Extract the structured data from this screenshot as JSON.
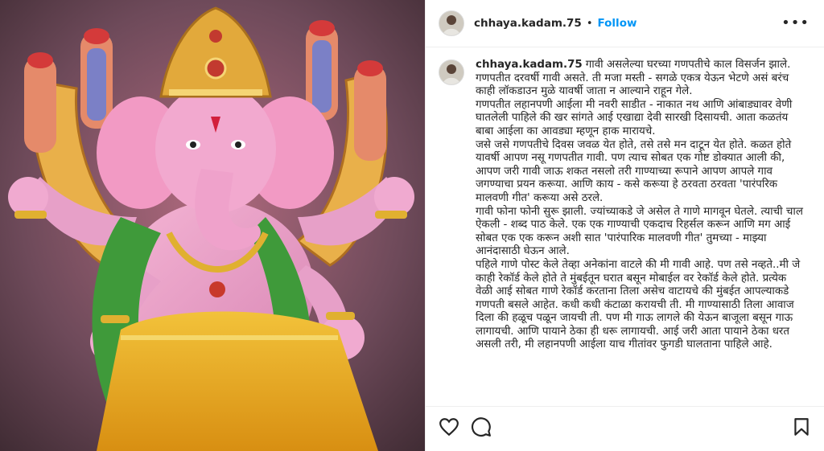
{
  "post": {
    "username": "chhaya.kadam.75",
    "separator": "•",
    "follow_label": "Follow",
    "more_icon": "more-options-icon",
    "caption_lines": [
      "गावी असलेल्या घरच्या गणपतीचे काल विसर्जन झाले.",
      "गणपतीत दरवर्षी गावी असते. ती मजा मस्ती - सगळे एकत्र येऊन भेटणे असं बरंच काही लॉकडाउन मुळे यावर्षी जाता न आल्याने राहून गेले.",
      "गणपतीत लहानपणी आईला मी नवरी साडीत - नाकात नथ आणि आंबाड्यावर वेणी घातलेली पाहिले की खर सांगते आई एखाद्या देवी सारखी दिसायची. आता कळतंय बाबा आईला का आवड्या म्हणून हाक मारायचे.",
      "जसे जसे गणपतीचे दिवस जवळ येत होते, तसे तसे मन दाटून येत होते. कळत होते यावर्षी आपण नसू गणपतीत गावी. पण त्याच सोबत एक गोष्ट डोक्यात आली की, आपण जरी गावी जाऊ शकत नसलो तरी गाण्याच्या रूपाने आपण आपले गाव जगण्याचा प्रयन करूया. आणि काय - कसे करूया हे ठरवता ठरवता 'पारंपरिक मालवणी गीत' करूया असे ठरले.",
      "गावी फोना फोनी सुरू झाली. ज्यांच्याकडे जे असेल ते गाणे मागवून घेतले. त्याची चाल ऐकली - शब्द पाठ केले. एक एक गाण्याची एकदाच रिहर्सल करून आणि मग आई सोबत एक एक करून अशी सात 'पारंपारिक मालवणी गीत' तुमच्या - माझ्या आनंदासाठी घेऊन आले.",
      "पहिले गाणे पोस्ट केले तेव्हा अनेकांना वाटले की मी गावी आहे. पण तसे नव्हते..मी जे काही रेकॉर्ड केले होते ते मुंबईतून घरात बसून मोबाईल वर रेकॉर्ड केले होते. प्रत्येक वेळी आई सोबत गाणे रेकॉर्ड करताना तिला असेच वाटायचे की मुंबईत आपल्याकडे गणपती बसले आहेत. कधी कधी कंटाळा करायची ती. मी गाण्यासाठी तिला आवाज दिला की हळूच पळून जायची ती. पण मी गाऊ लागले की येऊन बाजूला बसून गाऊ लागायची. आणि पायाने ठेका ही धरू लागायची. आई जरी आता पायाने ठेका धरत असली तरी, मी लहानपणी आईला याच गीतांवर फुगडी घालताना पाहिले आहे."
    ]
  },
  "actions": {
    "like_icon": "heart-icon",
    "comment_icon": "comment-icon",
    "save_icon": "bookmark-icon"
  },
  "colors": {
    "follow": "#0095f6",
    "text": "#262626",
    "border": "#efefef"
  }
}
